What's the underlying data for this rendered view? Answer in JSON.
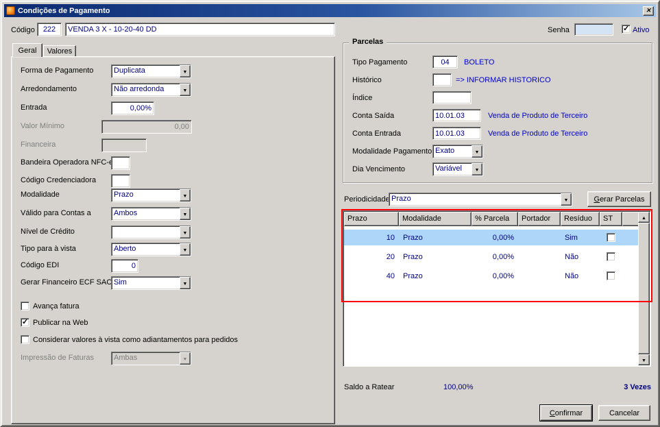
{
  "window": {
    "title": "Condições de Pagamento"
  },
  "icons": {
    "close": "✕",
    "dropdown": "▼",
    "scroll_up": "▲",
    "scroll_down": "▼",
    "check": "✓"
  },
  "colors": {
    "value_text": "#000080",
    "info_text": "#0000cc",
    "selection": "#aed6f8",
    "highlight_border": "#ff0000",
    "surface": "#d6d3ce"
  },
  "header": {
    "codigo_label": "Código",
    "codigo_value": "222",
    "descricao_value": "VENDA 3 X - 10-20-40 DD",
    "senha_label": "Senha",
    "senha_value": "",
    "ativo_label": "Ativo",
    "ativo_checked": true
  },
  "tabs": {
    "geral": "Geral",
    "valores": "Valores"
  },
  "geral": {
    "forma_pagamento": {
      "label": "Forma de Pagamento",
      "value": "Duplicata"
    },
    "arredondamento": {
      "label": "Arredondamento",
      "value": "Não arredonda"
    },
    "entrada": {
      "label": "Entrada",
      "value": "0,00%"
    },
    "valor_minimo": {
      "label": "Valor Mínimo",
      "value": "0,00"
    },
    "financeira": {
      "label": "Financeira",
      "value": ""
    },
    "bandeira": {
      "label": "Bandeira Operadora NFC-e",
      "value": ""
    },
    "credenciadora": {
      "label": "Código Credenciadora",
      "value": ""
    },
    "modalidade": {
      "label": "Modalidade",
      "value": "Prazo"
    },
    "valido_contas": {
      "label": "Válido para Contas a",
      "value": "Ambos"
    },
    "nivel_credito": {
      "label": "Nível de Crédito",
      "value": ""
    },
    "tipo_vista": {
      "label": "Tipo para à vista",
      "value": "Aberto"
    },
    "codigo_edi": {
      "label": "Código EDI",
      "value": "0"
    },
    "gerar_financeiro": {
      "label": "Gerar Financeiro ECF SAC",
      "value": "Sim"
    },
    "chk_avanca": {
      "label": "Avança fatura",
      "checked": false
    },
    "chk_publicar": {
      "label": "Publicar na Web",
      "checked": true
    },
    "chk_considerar": {
      "label": "Considerar valores à vista como adiantamentos para pedidos",
      "checked": false
    },
    "impressao": {
      "label": "Impressão de Faturas",
      "value": "Ambas"
    }
  },
  "parcelas": {
    "group_title": "Parcelas",
    "tipo_pagamento": {
      "label": "Tipo Pagamento",
      "value": "04",
      "desc": "BOLETO"
    },
    "historico": {
      "label": "Histórico",
      "value": "",
      "desc": "=> INFORMAR HISTORICO"
    },
    "indice": {
      "label": "Índice",
      "value": ""
    },
    "conta_saida": {
      "label": "Conta Saída",
      "value": "10.01.03",
      "desc": "Venda de Produto de Terceiro"
    },
    "conta_entrada": {
      "label": "Conta Entrada",
      "value": "10.01.03",
      "desc": "Venda de Produto de Terceiro"
    },
    "modalidade_pagamento": {
      "label": "Modalidade Pagamento",
      "value": "Exato"
    },
    "dia_vencimento": {
      "label": "Dia Vencimento",
      "value": "Variável"
    }
  },
  "periodicidade": {
    "label": "Periodicidade",
    "value": "Prazo",
    "button": "Gerar Parcelas"
  },
  "table": {
    "columns": [
      "Prazo",
      "Modalidade",
      "% Parcela",
      "Portador",
      "Resíduo",
      "ST"
    ],
    "rows": [
      {
        "prazo": "10",
        "modalidade": "Prazo",
        "parcela": "0,00%",
        "portador": "",
        "residuo": "Sim",
        "st": false,
        "selected": true
      },
      {
        "prazo": "20",
        "modalidade": "Prazo",
        "parcela": "0,00%",
        "portador": "",
        "residuo": "Não",
        "st": false,
        "selected": false
      },
      {
        "prazo": "40",
        "modalidade": "Prazo",
        "parcela": "0,00%",
        "portador": "",
        "residuo": "Não",
        "st": false,
        "selected": false
      }
    ]
  },
  "footer": {
    "saldo_label": "Saldo a Ratear",
    "saldo_value": "100,00%",
    "vezes": "3 Vezes",
    "confirmar": "Confirmar",
    "cancelar": "Cancelar"
  }
}
